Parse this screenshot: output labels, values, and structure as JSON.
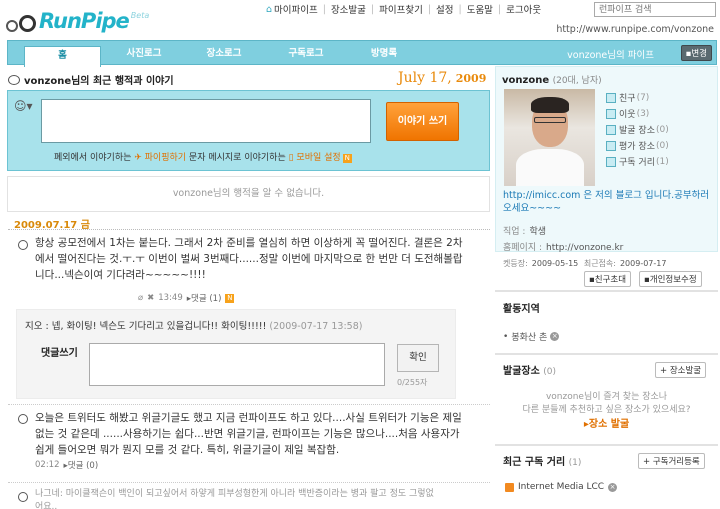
{
  "logo": {
    "text": "RunPipe",
    "beta": "Beta"
  },
  "topnav": {
    "items": [
      "마이파이프",
      "장소발굴",
      "파이프찾기",
      "설정",
      "도움말",
      "로그아웃"
    ]
  },
  "search": {
    "placeholder": "런파이프 검색"
  },
  "url": "http://www.runpipe.com/vonzone",
  "tabs": [
    "홈",
    "사진로그",
    "장소로그",
    "구독로그",
    "방명록"
  ],
  "owner_pipe": "vonzone님의 파이프",
  "change_btn": "▪변경",
  "headline": "vonzone님의 최근 행적과 이야기",
  "date": {
    "md": "July 17,",
    "year": "2009"
  },
  "write": {
    "button": "이야기 쓰기",
    "hint_a": "폐외에서 이야기하는 ",
    "hint_b": "파이핑하기",
    "hint_c": " 문자 메시지로 이야기하는 ",
    "hint_d": "모바일 설정",
    "badge": "N"
  },
  "empty_notice": "vonzone님의 행적을 알 수 없습니다.",
  "day_label": "2009.07.17 금",
  "posts": [
    {
      "text": "항상 공모전에서 1차는 붙는다. 그래서 2차 준비를 열심히 하면 이상하게 꼭 떨어진다. 결론은 2차에서 떨어진다는 것.ㅜ.ㅜ 이번이 벌써 3번째다......정말 이번에 마지막으로 한 번만 더 도전해볼랍니다...넥슨이여 기다려라~~~~~!!!!",
      "time": "13:49",
      "reply": "▸댓글 (1)"
    },
    {
      "text": "오늘은 트위터도 해봤고 위글기글도 했고 지금 런파이프도 하고 있다....사실 트위터가 기능은 제일 없는 것 같은데 ......사용하기는 쉽다...반면 위글기글, 런파이프는 기능은 많으나....처음 사용자가 쉽게 들어오면 뭐가 뭔지 모를 것 같다. 특히, 위글기글이 제일 복잡함.",
      "time": "02:12",
      "reply": "▸댓글 (0)"
    },
    {
      "text": "나그네: 마이클잭슨이 백인이 되고싶어서 하얗게 피부성형한게 아니라 백반증이라는 병과 팔고 정도 그렇없어요..",
      "time": "",
      "reply": ""
    }
  ],
  "comment": {
    "author": "지오 : ",
    "text": "넵, 화이팅! 넥슨도 기다리고 있을겁니다!! 화이팅!!!!!",
    "date": "(2009-07-17 13:58)",
    "label": "댓글쓰기",
    "submit": "확인",
    "count": "0/255자"
  },
  "profile": {
    "name": "vonzone",
    "sub": "(20대, 남자)",
    "links": [
      {
        "label": "친구",
        "count": "(7)"
      },
      {
        "label": "이웃",
        "count": "(3)"
      },
      {
        "label": "발굴 장소",
        "count": "(0)"
      },
      {
        "label": "평가 장소",
        "count": "(0)"
      },
      {
        "label": "구독 거리",
        "count": "(1)"
      }
    ],
    "blog": "http://imicc.com 은 저의 블로그 입니다.공부하러 오세요~~~~",
    "job_k": "직업 :",
    "job_v": "학생",
    "home_k": "홈페이지 :",
    "home_v": "http://vonzone.kr",
    "joined_k": "켓등장:",
    "joined_v": "2009-05-15",
    "recent_k": "최근접속:",
    "recent_v": "2009-07-17",
    "btn_friend": "▪친구초대",
    "btn_info": "▪개인정보수정"
  },
  "sections": {
    "area": {
      "title": "활동지역",
      "item": "봉화산 촌"
    },
    "places": {
      "title": "발굴장소",
      "count": "(0)",
      "btn": "+ 장소발굴",
      "line1": "vonzone님이 즐겨 찾는 장소나",
      "line2": "다른 분들께 추천하고 싶은 장소가 있으세요?",
      "link": "▸장소 발굴"
    },
    "subs": {
      "title": "최근 구독 거리",
      "count": "(1)",
      "btn": "+ 구독거리등록",
      "item": "Internet Media LCC"
    }
  }
}
